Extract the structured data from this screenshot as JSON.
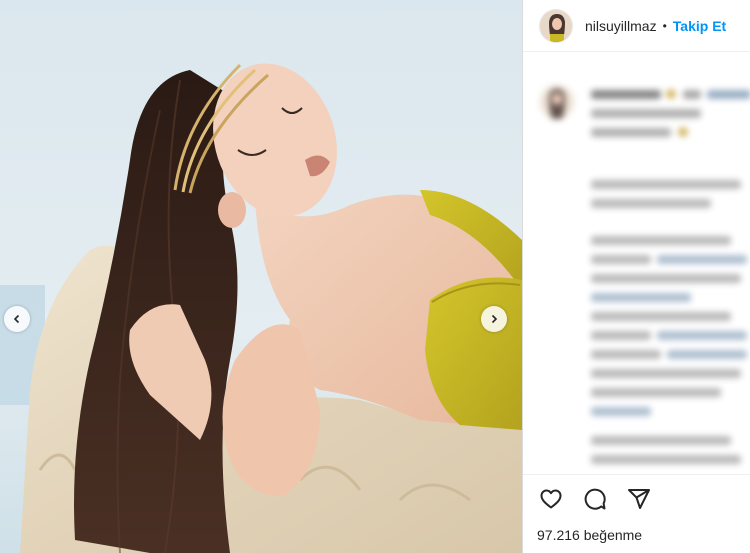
{
  "post": {
    "username": "nilsuyillmaz",
    "separator": "•",
    "follow_label": "Takip Et",
    "likes_count": "97.216",
    "likes_label": "beğenme"
  },
  "icons": {
    "like": "heart-icon",
    "comment": "comment-bubble-icon",
    "share": "paper-plane-icon",
    "prev": "chevron-left-icon",
    "next": "chevron-right-icon"
  },
  "colors": {
    "accent": "#0095f6",
    "text": "#262626",
    "border": "#dbdbdb",
    "sky": "#dde9ef",
    "rock": "#e4d7c0",
    "hair": "#2b1d17",
    "skin": "#efc7ae",
    "top": "#c9b925"
  }
}
